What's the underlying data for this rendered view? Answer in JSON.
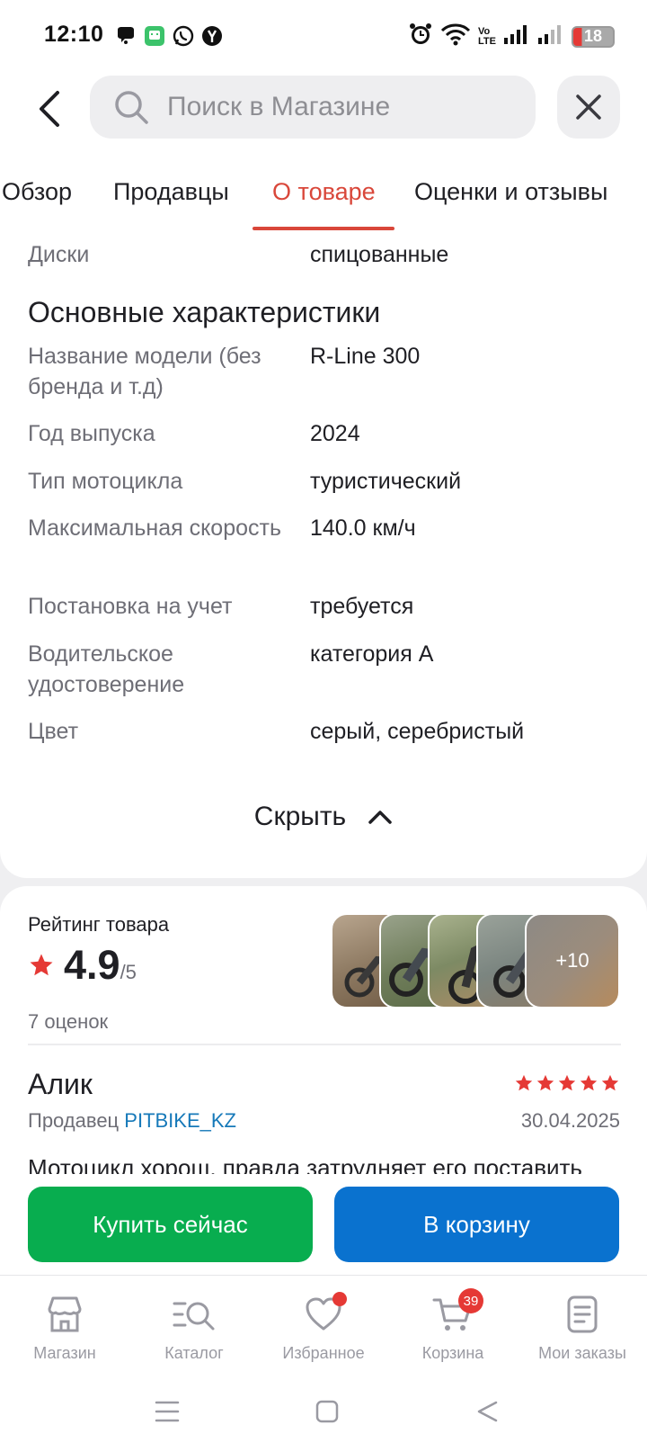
{
  "status_bar": {
    "time": "12:10",
    "network_label": "Vo\nLTE",
    "battery": "18"
  },
  "header": {
    "search_placeholder": "Поиск в Магазине"
  },
  "tabs": [
    {
      "label": "Обзор"
    },
    {
      "label": "Продавцы"
    },
    {
      "label": "О товаре",
      "active": true
    },
    {
      "label": "Оценки и отзывы"
    }
  ],
  "specs": {
    "top_row": {
      "label": "Диски",
      "value": "спицованные"
    },
    "section_title": "Основные характеристики",
    "rows": [
      {
        "label": "Название модели (без бренда и т.д)",
        "value": "R-Line 300"
      },
      {
        "label": "Год выпуска",
        "value": "2024"
      },
      {
        "label": "Тип мотоцикла",
        "value": "туристический"
      },
      {
        "label": "Максимальная скорость",
        "value": "140.0 км/ч"
      },
      {
        "label": "Постановка на учет",
        "value": "требуется"
      },
      {
        "label": "Водительское удостоверение",
        "value": "категория А"
      },
      {
        "label": "Цвет",
        "value": "серый, серебристый"
      }
    ],
    "hide_label": "Скрыть"
  },
  "reviews": {
    "title": "Рейтинг товара",
    "rating": "4.9",
    "rating_max": "/5",
    "count": "7 оценок",
    "photos_more": "+10",
    "review": {
      "author": "Алик",
      "seller_prefix": "Продавец",
      "seller_name": "PITBIKE_KZ",
      "date": "30.04.2025",
      "stars": 5,
      "text": "Мотоцикл хорош, правда затрудняет его поставить"
    }
  },
  "actions": {
    "buy_now": "Купить сейчас",
    "add_to_cart": "В корзину"
  },
  "bottom_nav": [
    {
      "label": "Магазин",
      "icon": "store-icon"
    },
    {
      "label": "Каталог",
      "icon": "catalog-search-icon"
    },
    {
      "label": "Избранное",
      "icon": "heart-icon",
      "dot": true
    },
    {
      "label": "Корзина",
      "icon": "cart-icon",
      "badge": "39"
    },
    {
      "label": "Мои заказы",
      "icon": "orders-icon"
    }
  ],
  "colors": {
    "accent_red": "#d9473a",
    "buy_green": "#08ad4f",
    "cart_blue": "#0a72cf",
    "seller_link": "#1679b9",
    "star": "#e53935"
  }
}
